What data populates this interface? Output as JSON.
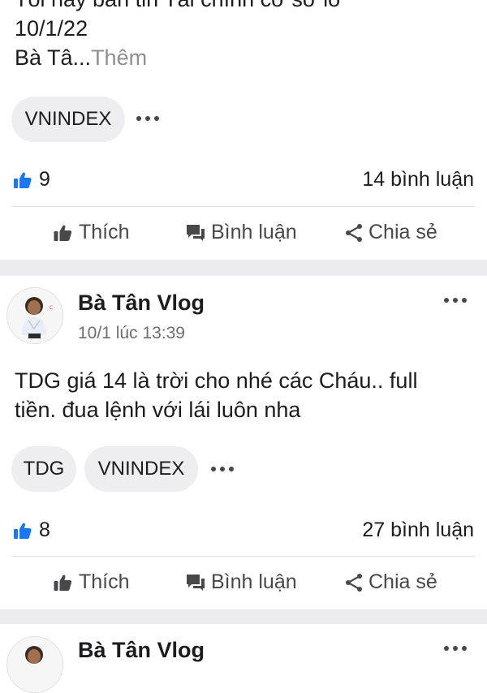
{
  "post1": {
    "text_partial_line": "Tôi hay bản tin Tài chính cơ sở lô",
    "text_line2": "10/1/22",
    "text_line3": "Bà Tâ...",
    "more_label": "Thêm",
    "tags": [
      "VNINDEX"
    ],
    "like_count": "9",
    "comment_count": "14 bình luận"
  },
  "post2": {
    "author": "Bà Tân Vlog",
    "timestamp": "10/1 lúc 13:39",
    "text_line1": "TDG giá 14 là trời cho nhé các Cháu.. full",
    "text_line2": "tiền. đua lệnh với lái luôn nha",
    "tags": [
      "TDG",
      "VNINDEX"
    ],
    "like_count": "8",
    "comment_count": "27 bình luận"
  },
  "post3": {
    "author": "Bà Tân Vlog"
  },
  "actions": {
    "like_label": "Thích",
    "comment_label": "Bình luận",
    "share_label": "Chia sẻ"
  },
  "icons": {
    "reaction": "thumbs-up-icon",
    "like": "thumbs-up-icon",
    "comment": "chat-bubble-icon",
    "share": "share-icon",
    "more": "more-dots-icon"
  },
  "colors": {
    "reaction_blue": "#1877f2",
    "action_gray": "#48484a",
    "separator": "#ececef"
  }
}
